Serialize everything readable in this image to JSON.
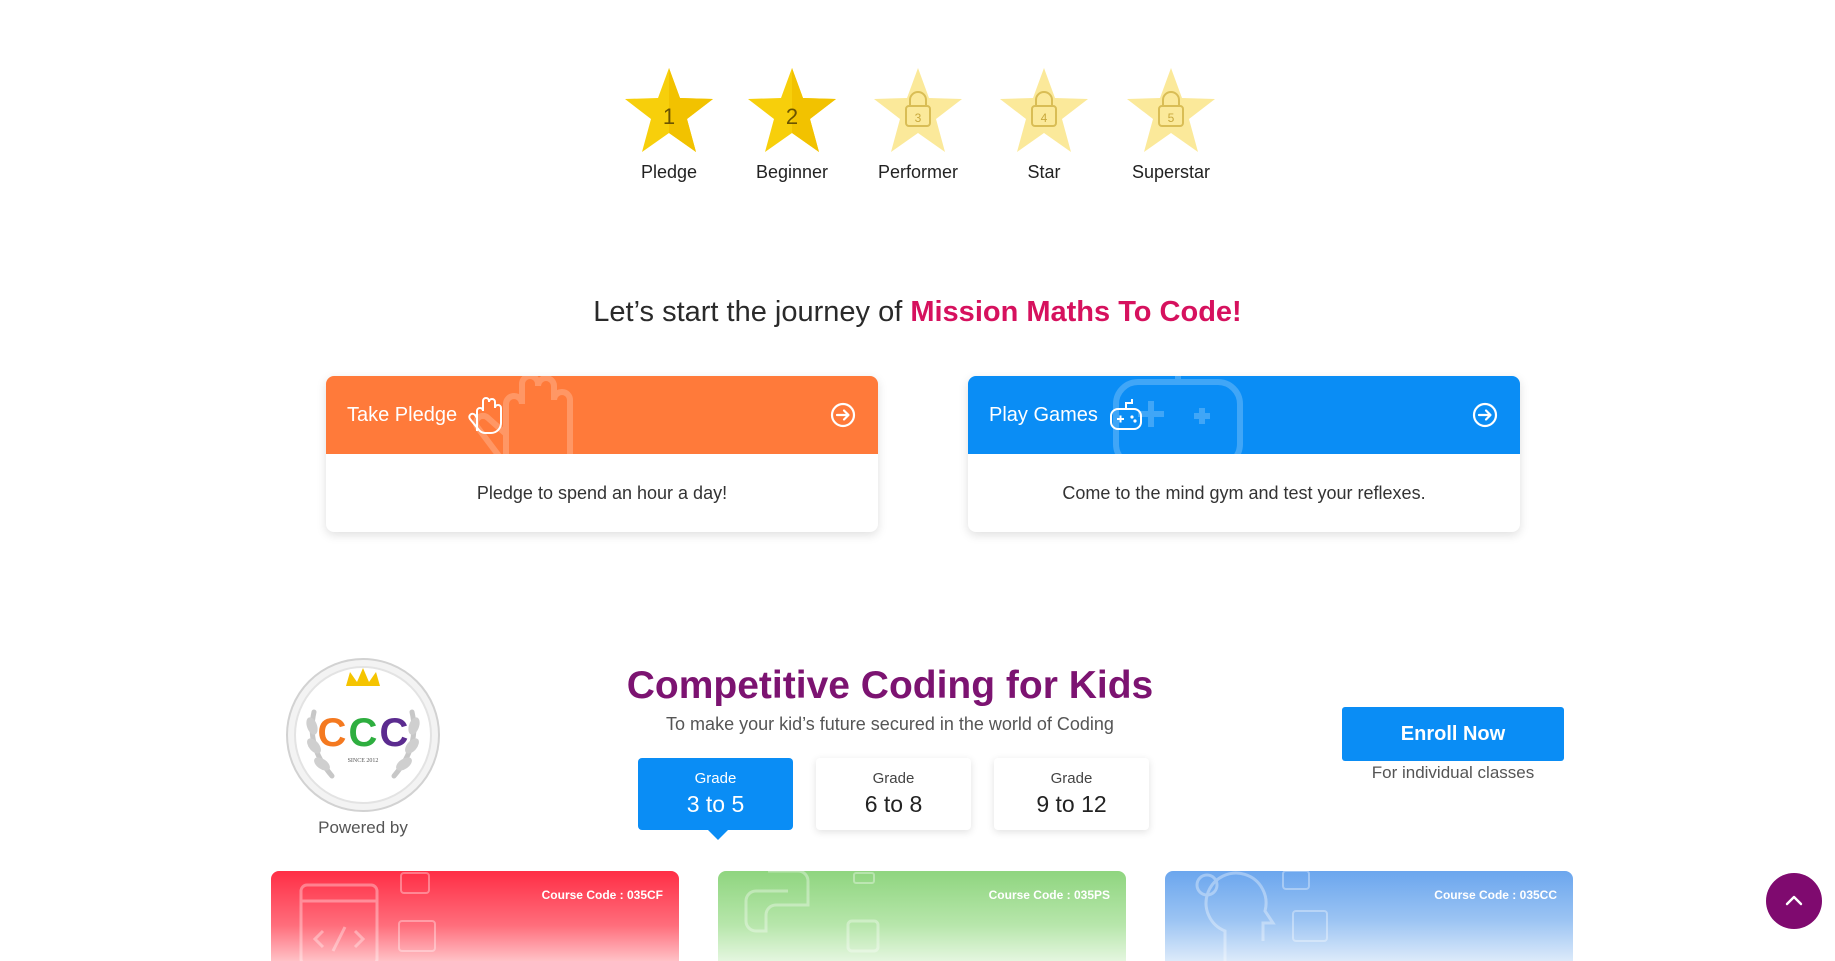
{
  "levels": [
    {
      "label": "Pledge",
      "number": "1",
      "unlocked": true
    },
    {
      "label": "Beginner",
      "number": "2",
      "unlocked": true
    },
    {
      "label": "Performer",
      "number": "3",
      "unlocked": false
    },
    {
      "label": "Star",
      "number": "4",
      "unlocked": false
    },
    {
      "label": "Superstar",
      "number": "5",
      "unlocked": false
    }
  ],
  "journey": {
    "prefix": "Let’s start the journey of ",
    "highlight": "Mission Maths To Code!",
    "cards": [
      {
        "title": "Take Pledge",
        "description": "Pledge to spend an hour a day!",
        "color": "#ff7a3a",
        "icon": "hand-icon"
      },
      {
        "title": "Play Games",
        "description": "Come to the mind gym and test your reflexes.",
        "color": "#0a8df5",
        "icon": "gamepad-icon"
      }
    ]
  },
  "competitive": {
    "title": "Competitive Coding for Kids",
    "subtitle": "To make your kid’s future secured in the world of Coding",
    "badge_text": "CCC",
    "badge_since": "SINCE 2012",
    "powered_by": "Powered by",
    "grades": [
      {
        "label": "Grade",
        "range": "3 to 5",
        "active": true
      },
      {
        "label": "Grade",
        "range": "6 to 8",
        "active": false
      },
      {
        "label": "Grade",
        "range": "9 to 12",
        "active": false
      }
    ],
    "enroll_label": "Enroll Now",
    "enroll_note": "For individual classes"
  },
  "courses": [
    {
      "code": "Course Code : 035CF"
    },
    {
      "code": "Course Code : 035PS"
    },
    {
      "code": "Course Code : 035CC"
    }
  ],
  "colors": {
    "star_gold": "#f7cf0b",
    "star_locked": "#fbe99a",
    "accent_blue": "#0a8df5",
    "accent_orange": "#ff7a3a",
    "highlight_pink": "#d6115e",
    "title_purple": "#7c1371",
    "scroll_top": "#7f0a6f"
  }
}
